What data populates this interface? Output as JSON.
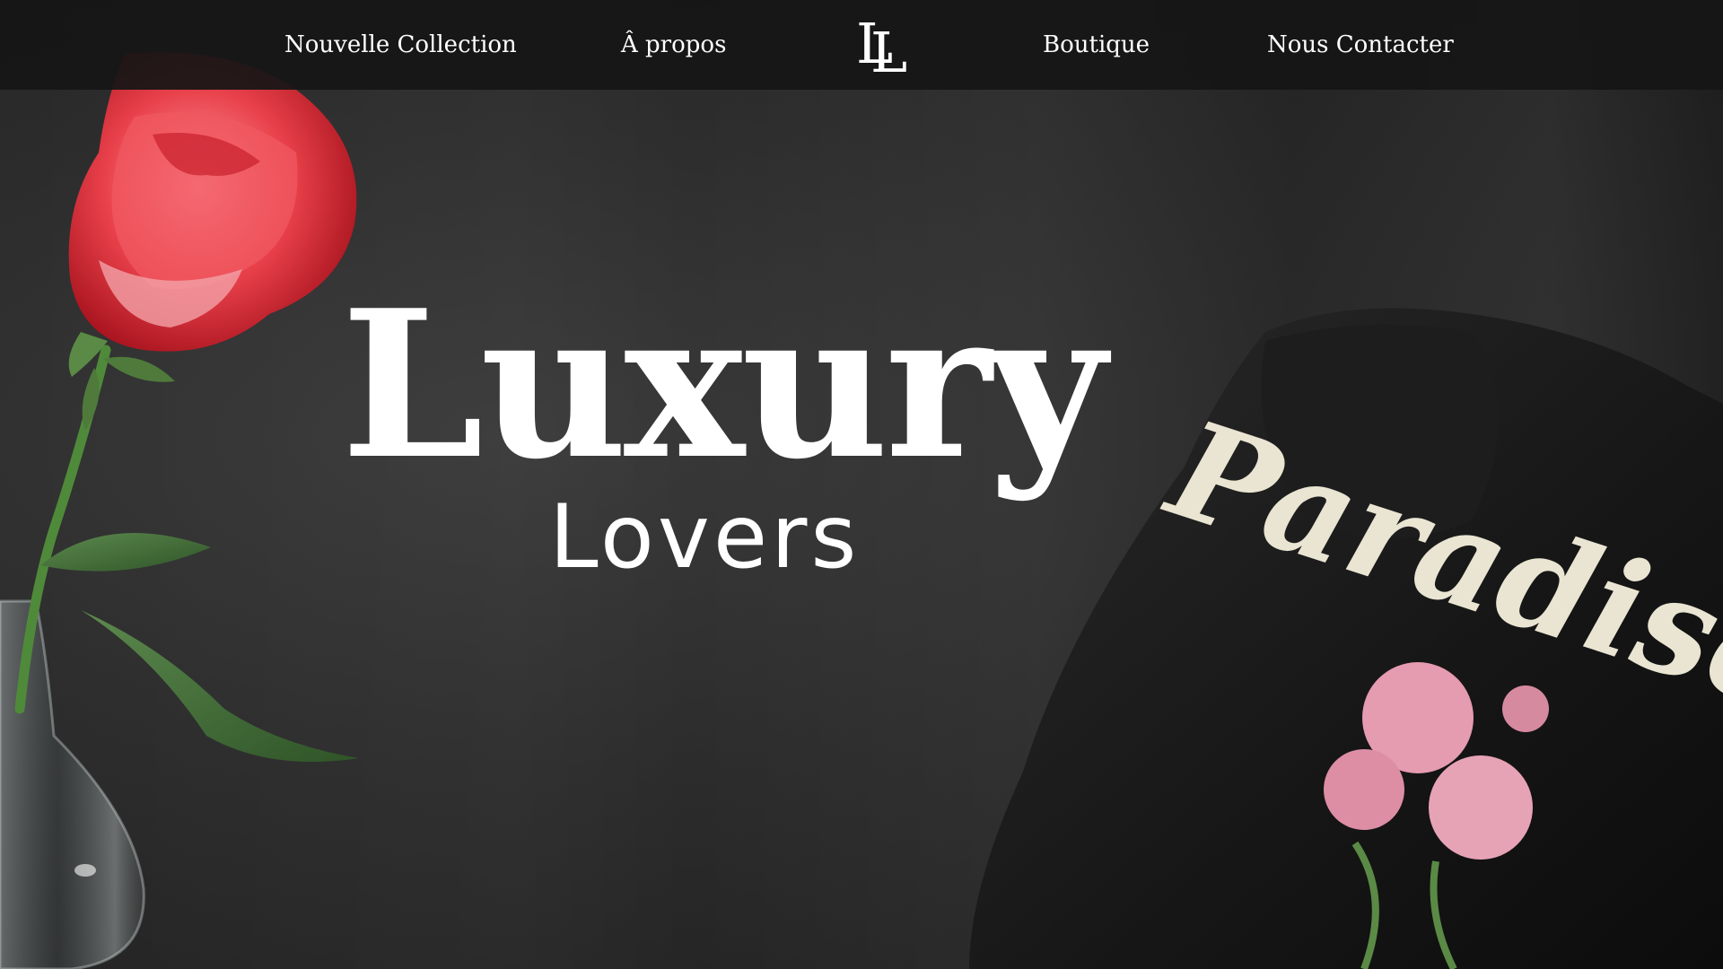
{
  "nav": {
    "links": [
      {
        "label": "Nouvelle Collection"
      },
      {
        "label": "Â propos"
      },
      {
        "label": "Boutique"
      },
      {
        "label": "Nous Contacter"
      }
    ],
    "logo_icon": "ll-monogram-logo"
  },
  "hero": {
    "title": "Luxury",
    "subtitle": "Lovers",
    "hoodie_print": "Paradise"
  },
  "colors": {
    "nav_background": "#161616",
    "text": "#ffffff",
    "background": "#2c2c2c",
    "rose": "#e0303a"
  }
}
